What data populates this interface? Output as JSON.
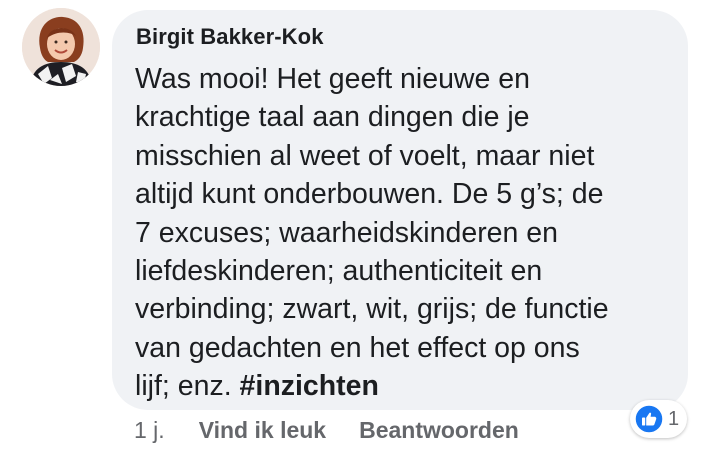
{
  "comment": {
    "author": "Birgit Bakker-Kok",
    "text_lines": [
      "Was mooi! Het geeft nieuwe en",
      "krachtige taal aan dingen die je",
      "misschien al weet of voelt, maar niet",
      "altijd kunt onderbouwen. De 5 g’s; de",
      "7 excuses; waarheidskinderen en",
      "liefdeskinderen; authenticiteit en",
      "verbinding; zwart, wit, grijs; de functie",
      "van gedachten en het effect op ons"
    ],
    "last_line_text": "lijf; enz. ",
    "hashtag": "#inzichten"
  },
  "actions": {
    "time": "1 j.",
    "like_label": "Vind ik leuk",
    "reply_label": "Beantwoorden"
  },
  "reactions": {
    "icon": "like-thumbs-up-icon",
    "count": "1"
  },
  "colors": {
    "bubble_bg": "#f0f2f5",
    "text": "#1c1e21",
    "secondary_text": "#65676b",
    "like_blue": "#1877f2"
  }
}
